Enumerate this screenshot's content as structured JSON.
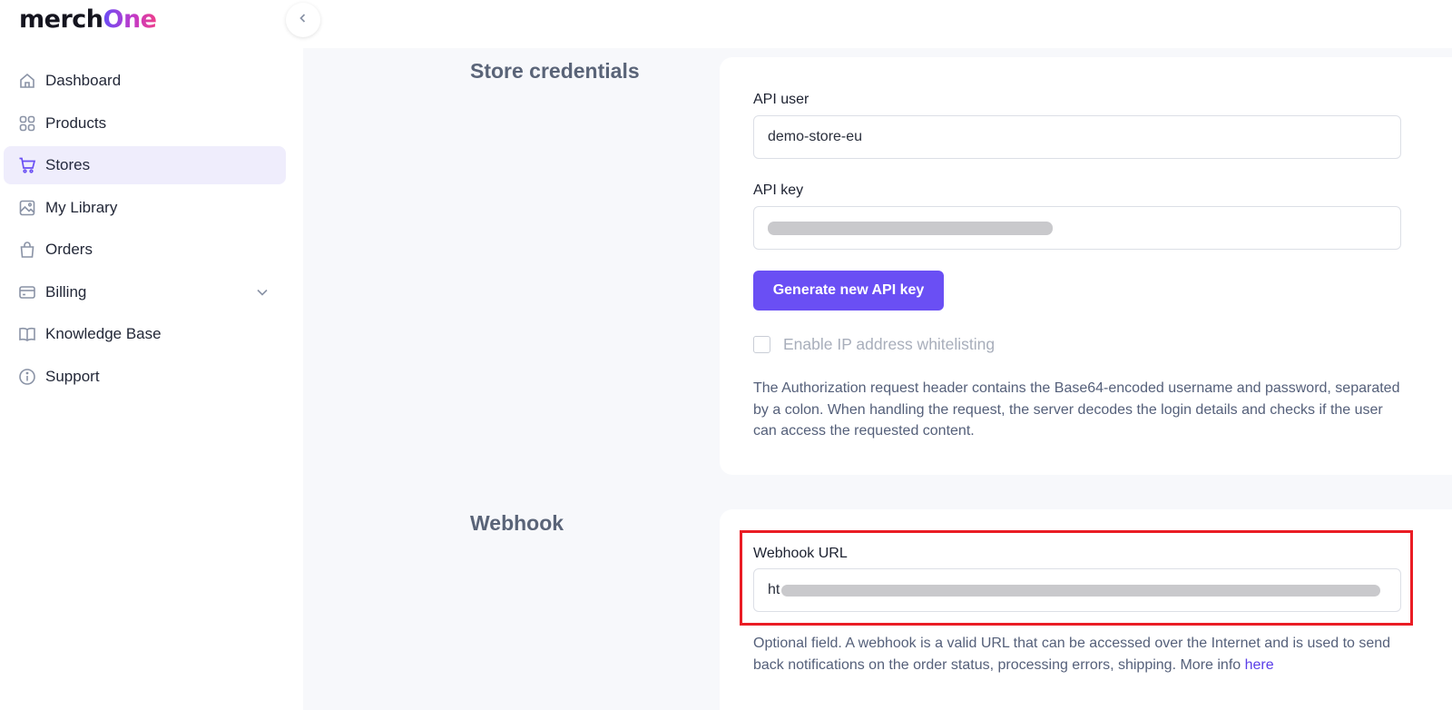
{
  "brand": {
    "prefix": "merch",
    "suffix": "One"
  },
  "sidebar": {
    "items": [
      {
        "label": "Dashboard",
        "icon": "home-icon"
      },
      {
        "label": "Products",
        "icon": "grid-icon"
      },
      {
        "label": "Stores",
        "icon": "cart-icon",
        "active": true
      },
      {
        "label": "My Library",
        "icon": "image-icon"
      },
      {
        "label": "Orders",
        "icon": "bag-icon"
      },
      {
        "label": "Billing",
        "icon": "credit-card-icon",
        "expandable": true
      },
      {
        "label": "Knowledge Base",
        "icon": "book-icon"
      },
      {
        "label": "Support",
        "icon": "info-icon"
      }
    ]
  },
  "credentials": {
    "title": "Store credentials",
    "api_user_label": "API user",
    "api_user_value": "demo-store-eu",
    "api_key_label": "API key",
    "generate_button": "Generate new API key",
    "whitelist_label": "Enable IP address whitelisting",
    "whitelist_checked": false,
    "help_text": "The Authorization request header contains the Base64-encoded username and password, separated by a colon. When handling the request, the server decodes the login details and checks if the user can access the requested content."
  },
  "webhook": {
    "title": "Webhook",
    "url_label": "Webhook URL",
    "url_visible_prefix": "ht",
    "help_text": "Optional field. A webhook is a valid URL that can be accessed over the Internet and is used to send back notifications on the order status, processing errors, shipping. More info ",
    "link_text": "here"
  },
  "colors": {
    "accent": "#6a4ff4",
    "active_nav_bg": "#efedfc",
    "highlight": "#ea1c24",
    "main_bg": "#f7f8fb"
  }
}
